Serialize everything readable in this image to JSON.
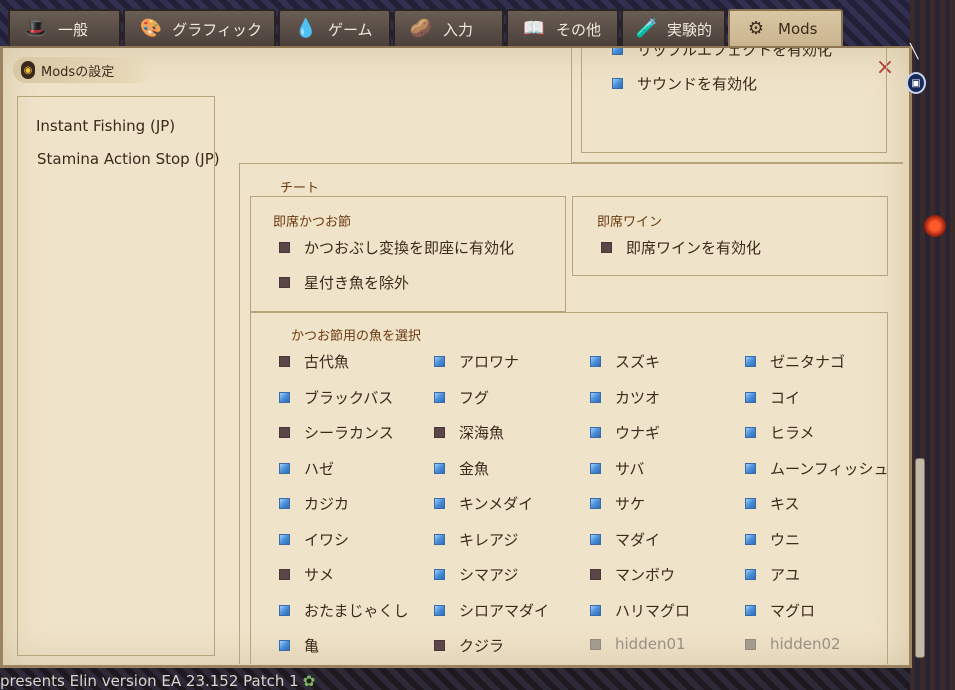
{
  "tabs": [
    {
      "label": "一般",
      "icon": "hat-icon",
      "glyph": "🎩",
      "active": false
    },
    {
      "label": "グラフィック",
      "icon": "palette-icon",
      "glyph": "🎨",
      "active": false
    },
    {
      "label": "ゲーム",
      "icon": "slime-icon",
      "glyph": "💧",
      "active": false
    },
    {
      "label": "入力",
      "icon": "mouse-icon",
      "glyph": "🥔",
      "active": false
    },
    {
      "label": "その他",
      "icon": "book-icon",
      "glyph": "📖",
      "active": false
    },
    {
      "label": "実験的",
      "icon": "flask-icon",
      "glyph": "🧪",
      "active": false
    },
    {
      "label": "Mods",
      "icon": "gear-icon",
      "glyph": "⚙",
      "active": true
    }
  ],
  "panel": {
    "title": "Modsの設定",
    "close_glyph": "×"
  },
  "mods": [
    "Instant Fishing (JP)",
    "Stamina Action Stop (JP)"
  ],
  "effects": {
    "items": [
      {
        "label": "リップルエフェクトを有効化",
        "checked": true
      },
      {
        "label": "サウンドを有効化",
        "checked": true
      }
    ]
  },
  "cheat": {
    "title": "チート",
    "katsuobushi": {
      "title": "即席かつお節",
      "items": [
        {
          "label": "かつおぶし変換を即座に有効化",
          "checked": false
        },
        {
          "label": "星付き魚を除外",
          "checked": false
        }
      ]
    },
    "wine": {
      "title": "即席ワイン",
      "items": [
        {
          "label": "即席ワインを有効化",
          "checked": false
        }
      ]
    },
    "fish_select": {
      "title": "かつお節用の魚を選択",
      "columns": [
        [
          {
            "label": "古代魚",
            "state": "off"
          },
          {
            "label": "ブラックバス",
            "state": "on"
          },
          {
            "label": "シーラカンス",
            "state": "off"
          },
          {
            "label": "ハゼ",
            "state": "on"
          },
          {
            "label": "カジカ",
            "state": "on"
          },
          {
            "label": "イワシ",
            "state": "on"
          },
          {
            "label": "サメ",
            "state": "off"
          },
          {
            "label": "おたまじゃくし",
            "state": "on"
          },
          {
            "label": "亀",
            "state": "on"
          }
        ],
        [
          {
            "label": "アロワナ",
            "state": "on"
          },
          {
            "label": "フグ",
            "state": "on"
          },
          {
            "label": "深海魚",
            "state": "off"
          },
          {
            "label": "金魚",
            "state": "on"
          },
          {
            "label": "キンメダイ",
            "state": "on"
          },
          {
            "label": "キレアジ",
            "state": "on"
          },
          {
            "label": "シマアジ",
            "state": "on"
          },
          {
            "label": "シロアマダイ",
            "state": "on"
          },
          {
            "label": "クジラ",
            "state": "off"
          }
        ],
        [
          {
            "label": "スズキ",
            "state": "on"
          },
          {
            "label": "カツオ",
            "state": "on"
          },
          {
            "label": "ウナギ",
            "state": "on"
          },
          {
            "label": "サバ",
            "state": "on"
          },
          {
            "label": "サケ",
            "state": "on"
          },
          {
            "label": "マダイ",
            "state": "on"
          },
          {
            "label": "マンボウ",
            "state": "off"
          },
          {
            "label": "ハリマグロ",
            "state": "on"
          },
          {
            "label": "hidden01",
            "state": "disabled"
          }
        ],
        [
          {
            "label": "ゼニタナゴ",
            "state": "on"
          },
          {
            "label": "コイ",
            "state": "on"
          },
          {
            "label": "ヒラメ",
            "state": "on"
          },
          {
            "label": "ムーンフィッシュ",
            "state": "on"
          },
          {
            "label": "キス",
            "state": "on"
          },
          {
            "label": "ウニ",
            "state": "on"
          },
          {
            "label": "アユ",
            "state": "on"
          },
          {
            "label": "マグロ",
            "state": "on"
          },
          {
            "label": "hidden02",
            "state": "disabled"
          }
        ]
      ]
    }
  },
  "status_bar": {
    "text": "presents Elin version EA 23.152 Patch 1"
  },
  "colors": {
    "panel_bg": "#efe3c9",
    "group_title": "#6a3a10",
    "checkbox_on": "#4a8fd8",
    "checkbox_off": "#5b4548",
    "close": "#b0403a"
  }
}
